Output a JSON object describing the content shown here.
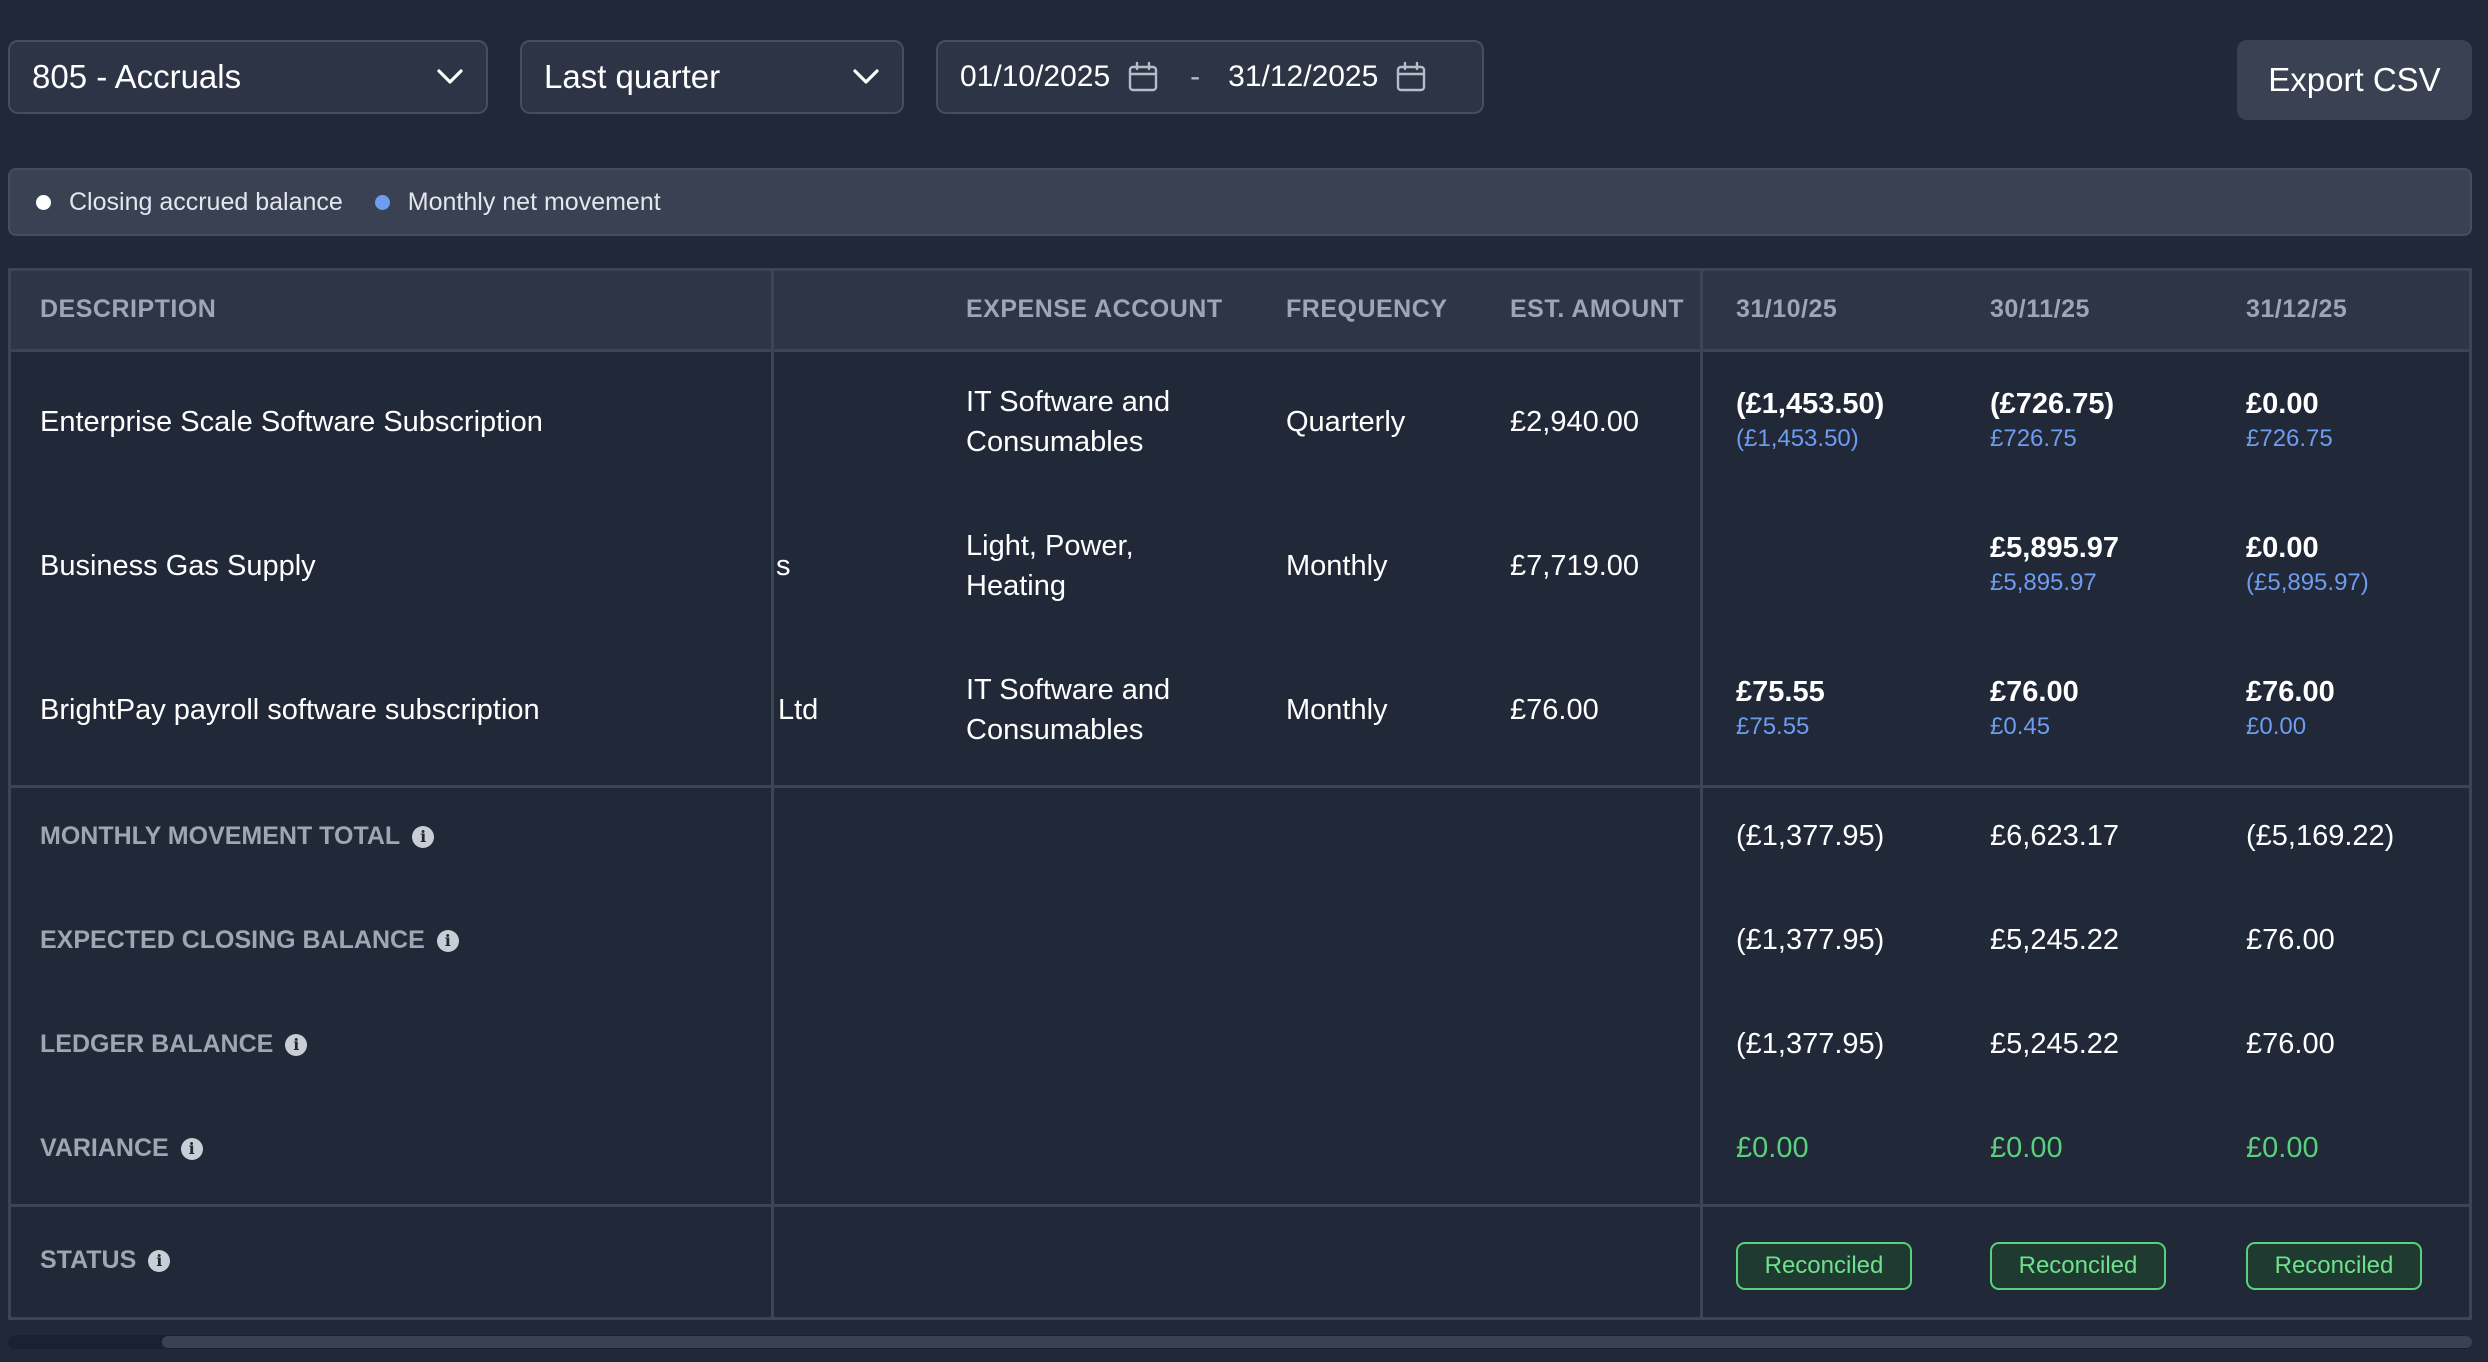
{
  "toolbar": {
    "account_select": "805 - Accruals",
    "period_select": "Last quarter",
    "date_from": "01/10/2025",
    "date_separator": "-",
    "date_to": "31/12/2025",
    "export_label": "Export CSV"
  },
  "legend": {
    "closing": "Closing accrued balance",
    "movement": "Monthly net movement",
    "closing_color": "#ffffff",
    "movement_color": "#6e9cf0"
  },
  "table": {
    "headers": {
      "description": "DESCRIPTION",
      "expense_account": "EXPENSE ACCOUNT",
      "frequency": "FREQUENCY",
      "est_amount": "EST. AMOUNT",
      "m1": "31/10/25",
      "m2": "30/11/25",
      "m3": "31/12/25"
    },
    "rows": [
      {
        "description": "Enterprise Scale Software Subscription",
        "supplier": "",
        "expense_line1": "IT Software and",
        "expense_line2": "Consumables",
        "frequency": "Quarterly",
        "est_amount": "£2,940.00",
        "m1_closing": "(£1,453.50)",
        "m1_movement": "(£1,453.50)",
        "m2_closing": "(£726.75)",
        "m2_movement": "£726.75",
        "m3_closing": "£0.00",
        "m3_movement": "£726.75"
      },
      {
        "description": "Business Gas Supply",
        "supplier": "s",
        "expense_line1": "Light, Power,",
        "expense_line2": "Heating",
        "frequency": "Monthly",
        "est_amount": "£7,719.00",
        "m1_closing": "",
        "m1_movement": "",
        "m2_closing": "£5,895.97",
        "m2_movement": "£5,895.97",
        "m3_closing": "£0.00",
        "m3_movement": "(£5,895.97)"
      },
      {
        "description": "BrightPay payroll software subscription",
        "supplier": "Ltd",
        "expense_line1": "IT Software and",
        "expense_line2": "Consumables",
        "frequency": "Monthly",
        "est_amount": "£76.00",
        "m1_closing": "£75.55",
        "m1_movement": "£75.55",
        "m2_closing": "£76.00",
        "m2_movement": "£0.45",
        "m3_closing": "£76.00",
        "m3_movement": "£0.00"
      }
    ],
    "summary": {
      "movement_total": {
        "label": "MONTHLY MOVEMENT TOTAL",
        "m1": "(£1,377.95)",
        "m2": "£6,623.17",
        "m3": "(£5,169.22)"
      },
      "expected_closing": {
        "label": "EXPECTED CLOSING BALANCE",
        "m1": "(£1,377.95)",
        "m2": "£5,245.22",
        "m3": "£76.00"
      },
      "ledger_balance": {
        "label": "LEDGER BALANCE",
        "m1": "(£1,377.95)",
        "m2": "£5,245.22",
        "m3": "£76.00"
      },
      "variance": {
        "label": "VARIANCE",
        "m1": "£0.00",
        "m2": "£0.00",
        "m3": "£0.00"
      }
    },
    "status": {
      "label": "STATUS",
      "m1": "Reconciled",
      "m2": "Reconciled",
      "m3": "Reconciled"
    },
    "info_glyph": "i"
  },
  "colors": {
    "background": "#212838",
    "positive": "#58d178",
    "movement_text": "#6e9cf0"
  }
}
